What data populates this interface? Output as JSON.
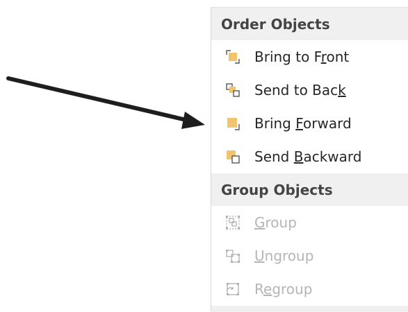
{
  "menu": {
    "sections": [
      {
        "header": "Order Objects",
        "items": [
          {
            "pre": "Bring to F",
            "accel": "r",
            "post": "ont",
            "icon": "bring-to-front-icon",
            "enabled": true
          },
          {
            "pre": "Send to Bac",
            "accel": "k",
            "post": "",
            "icon": "send-to-back-icon",
            "enabled": true
          },
          {
            "pre": "Bring ",
            "accel": "F",
            "post": "orward",
            "icon": "bring-forward-icon",
            "enabled": true
          },
          {
            "pre": "Send ",
            "accel": "B",
            "post": "ackward",
            "icon": "send-backward-icon",
            "enabled": true
          }
        ]
      },
      {
        "header": "Group Objects",
        "items": [
          {
            "pre": "",
            "accel": "G",
            "post": "roup",
            "icon": "group-icon",
            "enabled": false
          },
          {
            "pre": "",
            "accel": "U",
            "post": "ngroup",
            "icon": "ungroup-icon",
            "enabled": false
          },
          {
            "pre": "R",
            "accel": "e",
            "post": "group",
            "icon": "regroup-icon",
            "enabled": false
          }
        ]
      }
    ]
  },
  "colors": {
    "object_fill": "#f2c46d",
    "frame_stroke": "#555555",
    "disabled_stroke": "#b0b0b0",
    "arrow": "#1e1e1e"
  }
}
